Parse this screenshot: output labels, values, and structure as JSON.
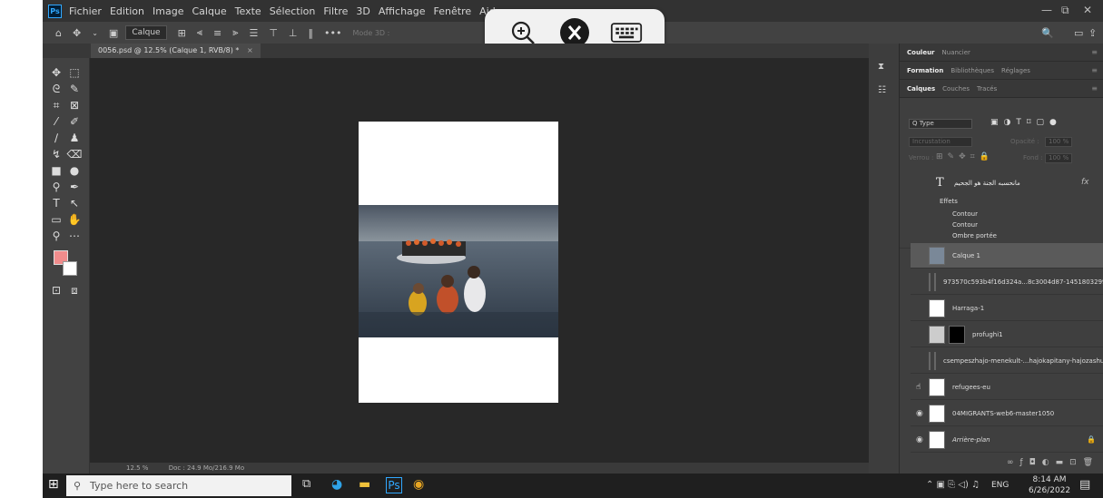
{
  "menubar": {
    "logo": "Ps",
    "items": [
      "Fichier",
      "Edition",
      "Image",
      "Calque",
      "Texte",
      "Sélection",
      "Filtre",
      "3D",
      "Affichage",
      "Fenêtre",
      "Aide"
    ]
  },
  "options": {
    "layer_select": "Calque",
    "mode3d": "Mode 3D :"
  },
  "document": {
    "tab_label": "0056.psd @ 12.5% (Calque 1, RVB/8) *",
    "close_glyph": "×"
  },
  "status": {
    "zoom": "12.5 %",
    "doc": "Doc : 24.9 Mo/216.9 Mo"
  },
  "panels": {
    "row1_tabs": [
      "Couleur",
      "Nuancier"
    ],
    "row2_tabs": [
      "Formation",
      "Bibliothèques",
      "Réglages"
    ],
    "row3_tabs": [
      "Calques",
      "Couches",
      "Tracés"
    ],
    "filter_label": "Q Type",
    "blend_mode": "Incrustation",
    "opacity_label": "Opacité :",
    "opacity_value": "100 %",
    "lock_label": "Verrou :",
    "fill_label": "Fond :",
    "fill_value": "100 %"
  },
  "layers": {
    "text_layer": "مانحسبه الجنة هو الجحيم",
    "effects_label": "Effets",
    "effects": [
      "Contour",
      "Contour",
      "Ombre portée"
    ],
    "items": [
      "Calque 1",
      "973570c593b4f16d324a...8c3004d87-1451803299",
      "Harraga-1",
      "profughi1",
      "csempeszhajo-menekult-...hajokapitany-hajozashu",
      "refugees-eu",
      "04MIGRANTS-web6-master1050",
      "Arrière-plan"
    ]
  },
  "taskbar": {
    "search_placeholder": "Type here to search",
    "lang": "ENG",
    "time": "8:14 AM",
    "date": "6/26/2022"
  }
}
